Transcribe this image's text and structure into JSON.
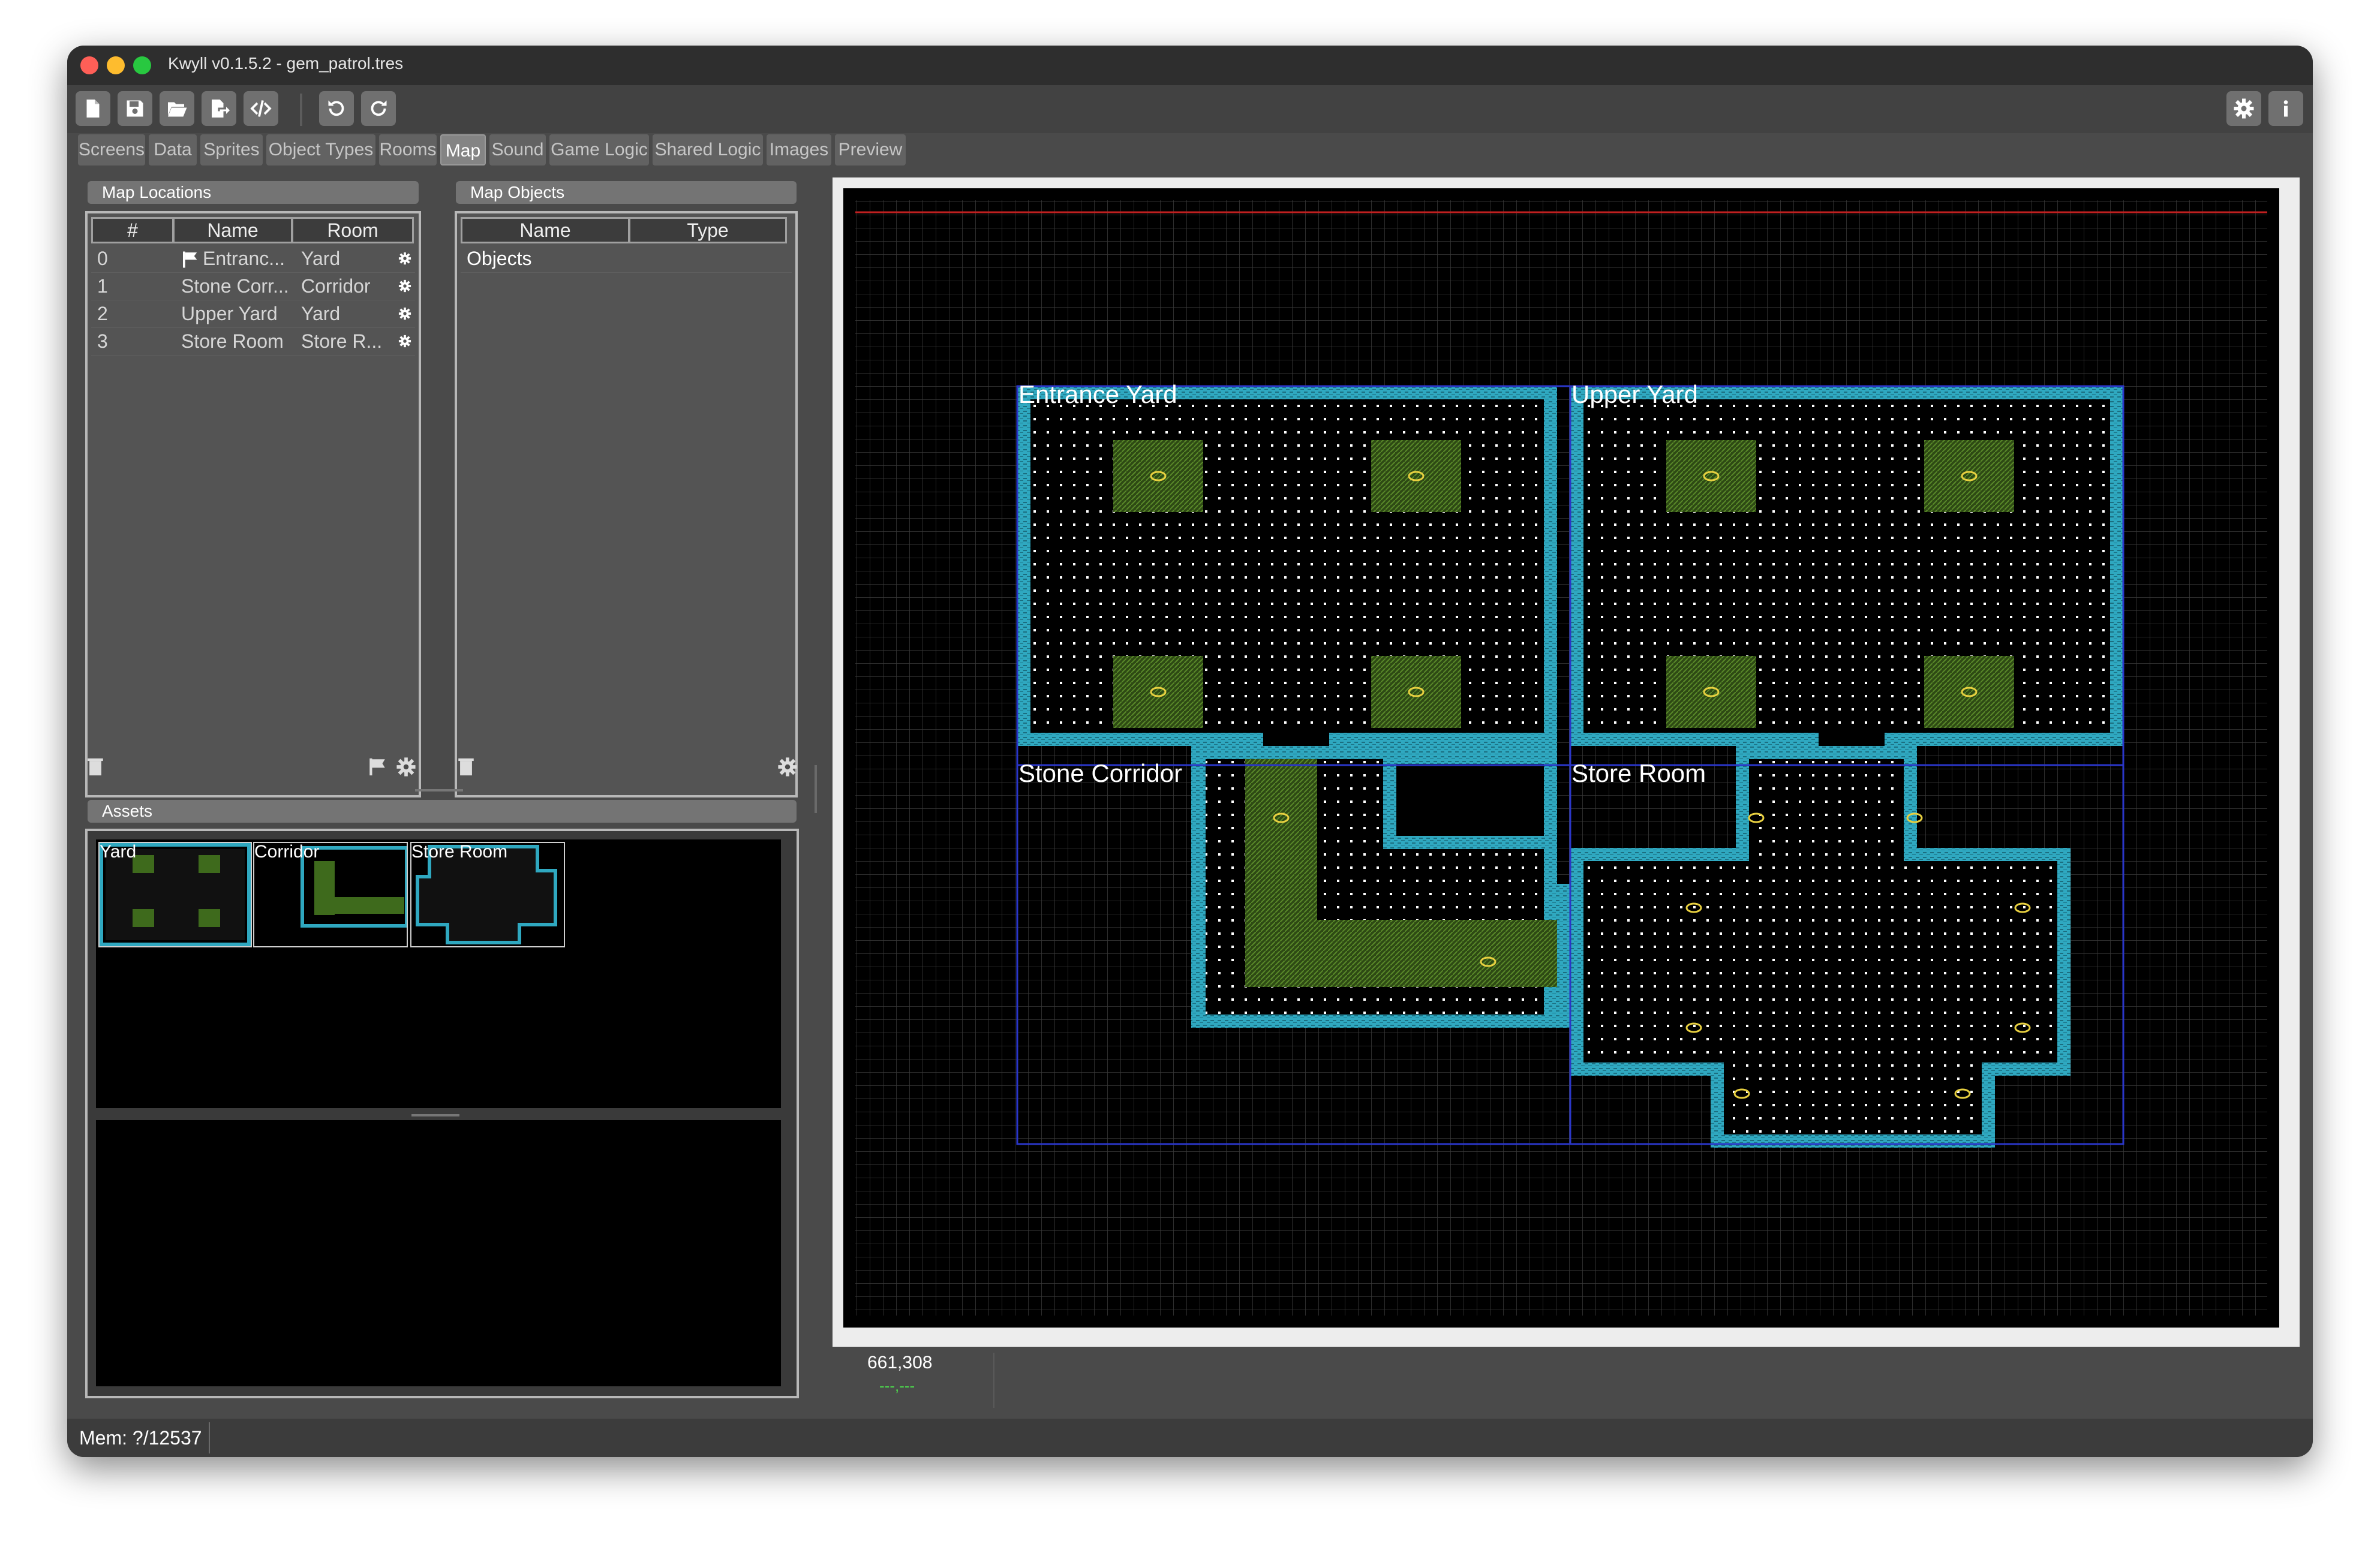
{
  "window": {
    "title": "Kwyll v0.1.5.2 - gem_patrol.tres"
  },
  "colors": {
    "close": "#ff5f57",
    "minimize": "#febc2e",
    "maximize": "#28c840",
    "wall": "#2fa8c0",
    "grid": "#3a3a3a",
    "grass": "#5a8a2a",
    "gem": "#e8d040",
    "room_border": "#2a36c8",
    "top_line": "#c02020"
  },
  "toolbar": {
    "left_icons": [
      "new-file-icon",
      "save-icon",
      "open-folder-icon",
      "export-icon",
      "code-icon"
    ],
    "history_icons": [
      "undo-icon",
      "redo-icon"
    ],
    "right_icons": [
      "settings-icon",
      "info-icon"
    ]
  },
  "tabs": [
    {
      "label": "Screens"
    },
    {
      "label": "Data"
    },
    {
      "label": "Sprites"
    },
    {
      "label": "Object Types"
    },
    {
      "label": "Rooms"
    },
    {
      "label": "Map",
      "active": true
    },
    {
      "label": "Sound"
    },
    {
      "label": "Game Logic"
    },
    {
      "label": "Shared Logic"
    },
    {
      "label": "Images"
    },
    {
      "label": "Preview"
    }
  ],
  "map_locations": {
    "title": "Map Locations",
    "columns": [
      "#",
      "Name",
      "Room"
    ],
    "rows": [
      {
        "num": "0",
        "name": "Entranc...",
        "room": "Yard",
        "flag": true
      },
      {
        "num": "1",
        "name": "Stone Corr...",
        "room": "Corridor"
      },
      {
        "num": "2",
        "name": "Upper Yard",
        "room": "Yard"
      },
      {
        "num": "3",
        "name": "Store Room",
        "room": "Store R..."
      }
    ]
  },
  "map_objects": {
    "title": "Map Objects",
    "columns": [
      "Name",
      "Type"
    ],
    "rows": [
      {
        "name": "Objects"
      }
    ]
  },
  "assets": {
    "title": "Assets",
    "items": [
      {
        "label": "Yard"
      },
      {
        "label": "Corridor"
      },
      {
        "label": "Store Room"
      }
    ]
  },
  "map": {
    "rooms": [
      {
        "label": "Entrance Yard"
      },
      {
        "label": "Upper Yard"
      },
      {
        "label": "Stone Corridor"
      },
      {
        "label": "Store Room"
      }
    ]
  },
  "status": {
    "coords": "661,308",
    "sub": "---,---",
    "mem": "Mem: ?/12537"
  }
}
